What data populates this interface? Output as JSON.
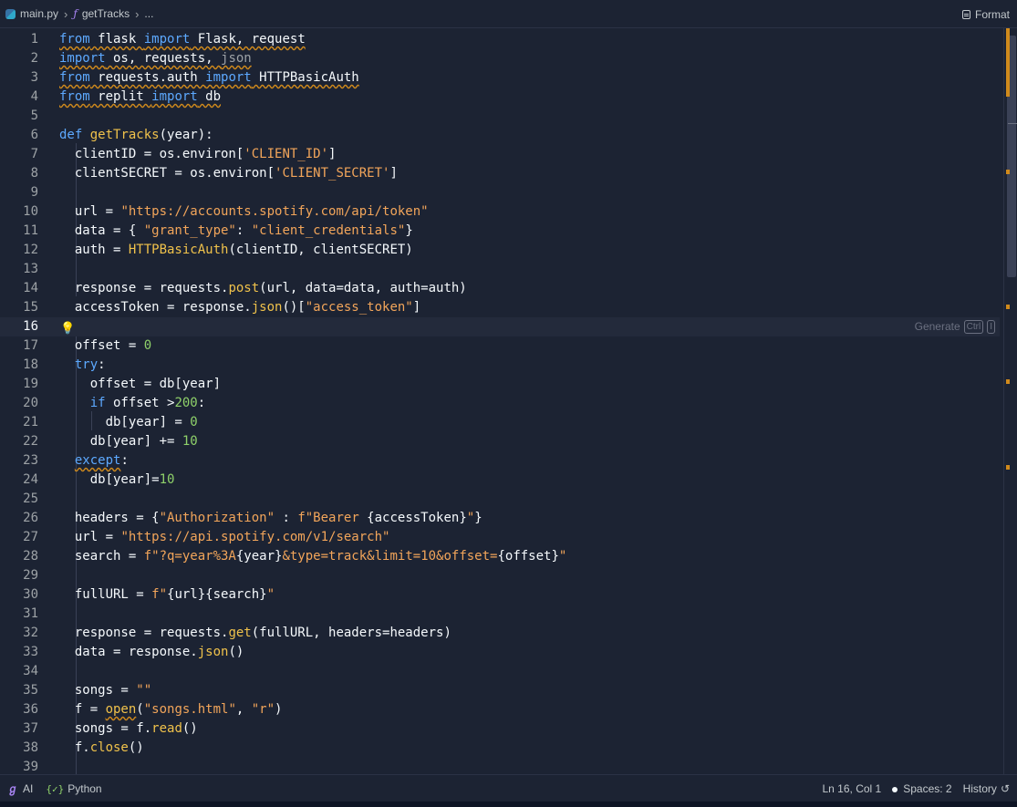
{
  "breadcrumb": {
    "file": "main.py",
    "function": "getTracks",
    "more": "..."
  },
  "toolbar": {
    "format_label": "Format"
  },
  "editor": {
    "active_line": 16,
    "ghost_hint": "Generate",
    "ghost_keys": [
      "Ctrl",
      "I"
    ]
  },
  "lines": [
    {
      "n": "1",
      "html": "<span class='kw-sq'>from</span><span class='sq'> flask </span><span class='kw-sq'>import</span><span class='sq'> Flask, request</span>"
    },
    {
      "n": "2",
      "html": "<span class='kw-sq'>import</span><span class='sq'> os, requests, </span><span class='dim'>json</span>"
    },
    {
      "n": "3",
      "html": "<span class='kw-sq'>from</span><span class='sq'> requests.auth </span><span class='kw-sq'>import</span><span class='sq'> HTTPBasicAuth</span>"
    },
    {
      "n": "4",
      "html": "<span class='kw-sq'>from</span><span class='sq'> replit </span><span class='kw-sq'>import</span><span class='sq'> db</span>"
    },
    {
      "n": "5",
      "html": ""
    },
    {
      "n": "6",
      "html": "<span class='kw'>def</span> <span class='fn'>getTracks</span>(year):"
    },
    {
      "n": "7",
      "html": "  clientID = os.environ[<span class='str'>'CLIENT_ID'</span>]"
    },
    {
      "n": "8",
      "html": "  clientSECRET = os.environ[<span class='str'>'CLIENT_SECRET'</span>]"
    },
    {
      "n": "9",
      "html": ""
    },
    {
      "n": "10",
      "html": "  url = <span class='str'>\"https://accounts.spotify.com/api/token\"</span>"
    },
    {
      "n": "11",
      "html": "  data = { <span class='str'>\"grant_type\"</span>: <span class='str'>\"client_credentials\"</span>}"
    },
    {
      "n": "12",
      "html": "  auth = <span class='fn'>HTTPBasicAuth</span>(clientID, clientSECRET)"
    },
    {
      "n": "13",
      "html": ""
    },
    {
      "n": "14",
      "html": "  response = requests.<span class='fn'>post</span>(url, data=data, auth=auth)"
    },
    {
      "n": "15",
      "html": "  accessToken = response.<span class='fn'>json</span>()[<span class='str'>\"access_token\"</span>]"
    },
    {
      "n": "16",
      "html": ""
    },
    {
      "n": "17",
      "html": "  offset = <span class='num'>0</span>"
    },
    {
      "n": "18",
      "html": "  <span class='kw'>try</span>:"
    },
    {
      "n": "19",
      "html": "    offset = db[year]"
    },
    {
      "n": "20",
      "html": "    <span class='kw'>if</span> offset &gt;<span class='num'>200</span>:"
    },
    {
      "n": "21",
      "html": "      db[year] = <span class='num'>0</span>"
    },
    {
      "n": "22",
      "html": "    db[year] += <span class='num'>10</span>"
    },
    {
      "n": "23",
      "html": "  <span class='kw-sq'>except</span>:"
    },
    {
      "n": "24",
      "html": "    db[year]=<span class='num'>10</span>"
    },
    {
      "n": "25",
      "html": ""
    },
    {
      "n": "26",
      "html": "  headers = {<span class='str'>\"Authorization\"</span> : <span class='str'>f\"Bearer </span>{accessToken}<span class='str'>\"</span>}"
    },
    {
      "n": "27",
      "html": "  url = <span class='str'>\"https://api.spotify.com/v1/search\"</span>"
    },
    {
      "n": "28",
      "html": "  search = <span class='str'>f\"?q=year%3A</span>{year}<span class='str'>&amp;type=track&amp;limit=10&amp;offset=</span>{offset}<span class='str'>\"</span>"
    },
    {
      "n": "29",
      "html": ""
    },
    {
      "n": "30",
      "html": "  fullURL = <span class='str'>f\"</span>{url}{search}<span class='str'>\"</span>"
    },
    {
      "n": "31",
      "html": ""
    },
    {
      "n": "32",
      "html": "  response = requests.<span class='fn'>get</span>(fullURL, headers=headers)"
    },
    {
      "n": "33",
      "html": "  data = response.<span class='fn'>json</span>()"
    },
    {
      "n": "34",
      "html": ""
    },
    {
      "n": "35",
      "html": "  songs = <span class='str'>\"\"</span>"
    },
    {
      "n": "36",
      "html": "  f = <span class='fn sq'>open</span>(<span class='str'>\"songs.html\"</span>, <span class='str'>\"r\"</span>)"
    },
    {
      "n": "37",
      "html": "  songs = f.<span class='fn'>read</span>()"
    },
    {
      "n": "38",
      "html": "  f.<span class='fn'>close</span>()"
    },
    {
      "n": "39",
      "html": ""
    }
  ],
  "status": {
    "ai_label": "AI",
    "language": "Python",
    "cursor": "Ln 16, Col 1",
    "spaces": "Spaces: 2",
    "history": "History"
  },
  "colors": {
    "background": "#1c2333",
    "keyword": "#5da9ff",
    "string": "#f2a55a",
    "number": "#8fd16a",
    "function": "#f0c24b",
    "warning": "#d08a1c"
  }
}
